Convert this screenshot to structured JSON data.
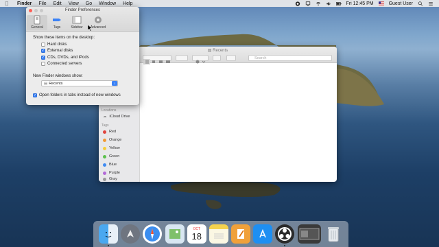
{
  "menubar": {
    "app_name": "Finder",
    "items": [
      "File",
      "Edit",
      "View",
      "Go",
      "Window",
      "Help"
    ],
    "clock": "Fri 12:45 PM",
    "user": "Guest User"
  },
  "prefs": {
    "title": "Finder Preferences",
    "tabs": [
      {
        "label": "General",
        "icon": "general-switch-icon"
      },
      {
        "label": "Tags",
        "icon": "tag-icon"
      },
      {
        "label": "Sidebar",
        "icon": "sidebar-icon"
      },
      {
        "label": "Advanced",
        "icon": "gear-icon"
      }
    ],
    "show_label": "Show these items on the desktop:",
    "items": [
      {
        "label": "Hard disks",
        "checked": false
      },
      {
        "label": "External disks",
        "checked": true
      },
      {
        "label": "CDs, DVDs, and iPods",
        "checked": true
      },
      {
        "label": "Connected servers",
        "checked": false
      }
    ],
    "new_window_label": "New Finder windows show:",
    "new_window_value": "Recents",
    "open_tabs_label": "Open folders in tabs instead of new windows",
    "open_tabs_checked": true
  },
  "finder": {
    "title": "Recents",
    "search_placeholder": "Search",
    "locations_header": "Locations",
    "icloud": "iCloud Drive",
    "tags_header": "Tags",
    "tags": [
      {
        "name": "Red",
        "color": "#e0443e"
      },
      {
        "name": "Orange",
        "color": "#f19a37"
      },
      {
        "name": "Yellow",
        "color": "#f5cd3d"
      },
      {
        "name": "Green",
        "color": "#5cc14d"
      },
      {
        "name": "Blue",
        "color": "#3f8bf2"
      },
      {
        "name": "Purple",
        "color": "#b36ad8"
      },
      {
        "name": "Gray",
        "color": "#9a9a9a"
      }
    ]
  },
  "dock": {
    "calendar_day": "18",
    "calendar_month": "OCT"
  }
}
